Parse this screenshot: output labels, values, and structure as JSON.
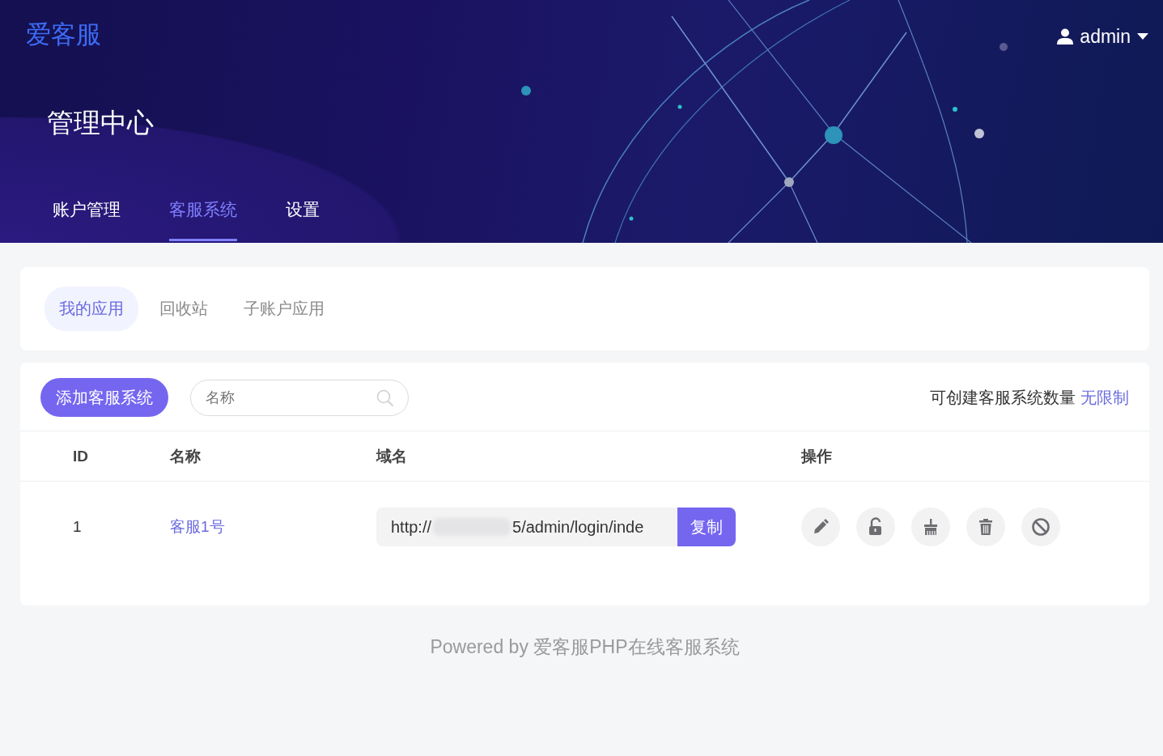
{
  "header": {
    "logo": "爱客服",
    "user": "admin",
    "title": "管理中心"
  },
  "nav_tabs": [
    {
      "label": "账户管理",
      "selected": false
    },
    {
      "label": "客服系统",
      "selected": true
    },
    {
      "label": "设置",
      "selected": false
    }
  ],
  "sub_tabs": [
    {
      "label": "我的应用",
      "selected": true
    },
    {
      "label": "回收站",
      "selected": false
    },
    {
      "label": "子账户应用",
      "selected": false
    }
  ],
  "toolbar": {
    "add_button": "添加客服系统",
    "search": {
      "placeholder": "名称"
    },
    "quota_label": "可创建客服系统数量",
    "quota_value": "无限制"
  },
  "table": {
    "columns": [
      "ID",
      "名称",
      "域名",
      "操作"
    ],
    "rows": [
      {
        "id": "1",
        "name": "客服1号",
        "domain_start": "http://",
        "domain_end": "5/admin/login/inde",
        "copy_button": "复制",
        "actions": [
          {
            "kind": "edit"
          },
          {
            "kind": "unlock"
          },
          {
            "kind": "clear"
          },
          {
            "kind": "delete"
          },
          {
            "kind": "disable"
          }
        ]
      }
    ]
  },
  "footer": "Powered by 爱客服PHP在线客服系统"
}
